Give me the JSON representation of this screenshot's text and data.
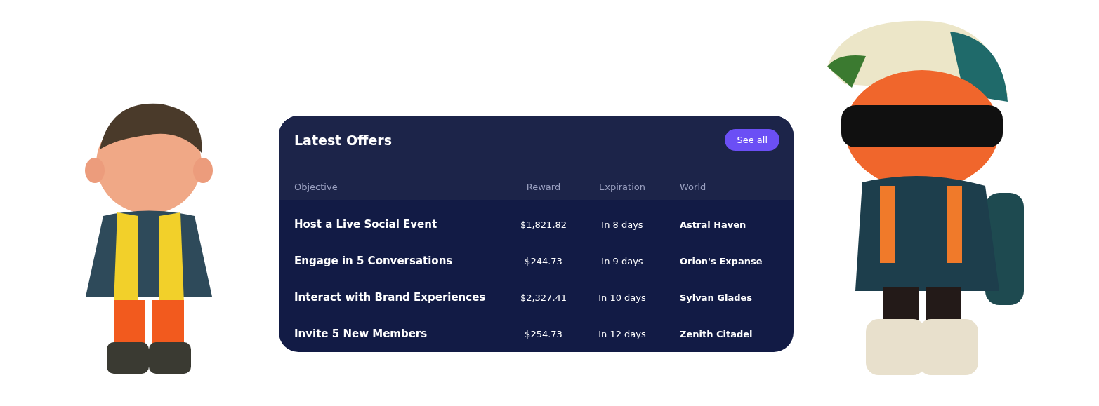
{
  "card": {
    "title": "Latest Offers",
    "action": "See all"
  },
  "table": {
    "columns": [
      "Objective",
      "Reward",
      "Expiration",
      "World"
    ],
    "rows": [
      {
        "objective": "Host a Live Social Event",
        "reward": "$1,821.82",
        "expiration": "In 8 days",
        "world": "Astral Haven"
      },
      {
        "objective": "Engage in 5 Conversations",
        "reward": "$244.73",
        "expiration": "In 9 days",
        "world": "Orion's Expanse"
      },
      {
        "objective": "Interact with Brand Experiences",
        "reward": "$2,327.41",
        "expiration": "In 10 days",
        "world": "Sylvan Glades"
      },
      {
        "objective": "Invite 5 New Members",
        "reward": "$254.73",
        "expiration": "In 12 days",
        "world": "Zenith Citadel"
      }
    ]
  }
}
